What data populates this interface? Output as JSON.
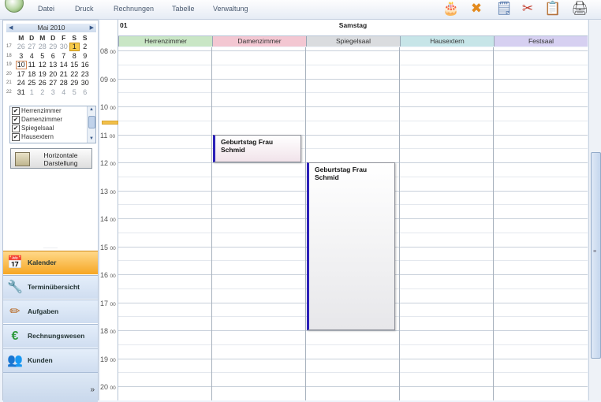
{
  "menu": [
    "Datei",
    "Druck",
    "Rechnungen",
    "Tabelle",
    "Verwaltung"
  ],
  "toolbar_icons": [
    "cake-icon",
    "cross-icon",
    "note-icon",
    "scissors-icon",
    "clipboard-icon",
    "printer-icon"
  ],
  "mini_calendar": {
    "month_label": "Mai 2010",
    "weekdays": [
      "M",
      "D",
      "M",
      "D",
      "F",
      "S",
      "S"
    ],
    "weeks": [
      {
        "wk": "17",
        "days": [
          "26",
          "27",
          "28",
          "29",
          "30",
          "1",
          "2"
        ]
      },
      {
        "wk": "18",
        "days": [
          "3",
          "4",
          "5",
          "6",
          "7",
          "8",
          "9"
        ]
      },
      {
        "wk": "19",
        "days": [
          "10",
          "11",
          "12",
          "13",
          "14",
          "15",
          "16"
        ]
      },
      {
        "wk": "20",
        "days": [
          "17",
          "18",
          "19",
          "20",
          "21",
          "22",
          "23"
        ]
      },
      {
        "wk": "21",
        "days": [
          "24",
          "25",
          "26",
          "27",
          "28",
          "29",
          "30"
        ]
      },
      {
        "wk": "22",
        "days": [
          "31",
          "1",
          "2",
          "3",
          "4",
          "5",
          "6"
        ]
      }
    ],
    "selected_day": "1",
    "today_day": "10"
  },
  "rooms": [
    {
      "label": "Herrenzimmer",
      "checked": true
    },
    {
      "label": "Damenzimmer",
      "checked": true
    },
    {
      "label": "Spiegelsaal",
      "checked": true
    },
    {
      "label": "Hausextern",
      "checked": true
    }
  ],
  "horizontal_button": {
    "line1": "Horizontale",
    "line2": "Darstellung"
  },
  "nav": [
    {
      "label": "Kalender",
      "icon": "calendar-icon",
      "active": true
    },
    {
      "label": "Terminübersicht",
      "icon": "overview-icon",
      "active": false
    },
    {
      "label": "Aufgaben",
      "icon": "tasks-icon",
      "active": false
    },
    {
      "label": "Rechnungswesen",
      "icon": "euro-icon",
      "active": false
    },
    {
      "label": "Kunden",
      "icon": "customers-icon",
      "active": false
    }
  ],
  "nav_more": "»",
  "day_view": {
    "date_number": "01",
    "day_name": "Samstag",
    "columns": [
      {
        "label": "Herrenzimmer",
        "color": "#c9e6c5"
      },
      {
        "label": "Damenzimmer",
        "color": "#f3c7d2"
      },
      {
        "label": "Spiegelsaal",
        "color": "#dadcdf"
      },
      {
        "label": "Hausextern",
        "color": "#c7e5e8"
      },
      {
        "label": "Festsaal",
        "color": "#d6d0f1"
      }
    ],
    "hours": [
      {
        "h": "08",
        "m": "00"
      },
      {
        "h": "09",
        "m": "00"
      },
      {
        "h": "10",
        "m": "00"
      },
      {
        "h": "11",
        "m": "00"
      },
      {
        "h": "12",
        "m": "00"
      },
      {
        "h": "13",
        "m": "00"
      },
      {
        "h": "14",
        "m": "00"
      },
      {
        "h": "15",
        "m": "00"
      },
      {
        "h": "16",
        "m": "00"
      },
      {
        "h": "17",
        "m": "00"
      },
      {
        "h": "18",
        "m": "00"
      },
      {
        "h": "19",
        "m": "00"
      },
      {
        "h": "20",
        "m": "00"
      }
    ],
    "appointments": [
      {
        "title": "Geburtstag Frau Schmid",
        "column": 1,
        "start": "11:00",
        "end": "12:00"
      },
      {
        "title": "Geburtstag Frau Schmid",
        "column": 2,
        "start": "12:00",
        "end": "18:00"
      }
    ]
  }
}
